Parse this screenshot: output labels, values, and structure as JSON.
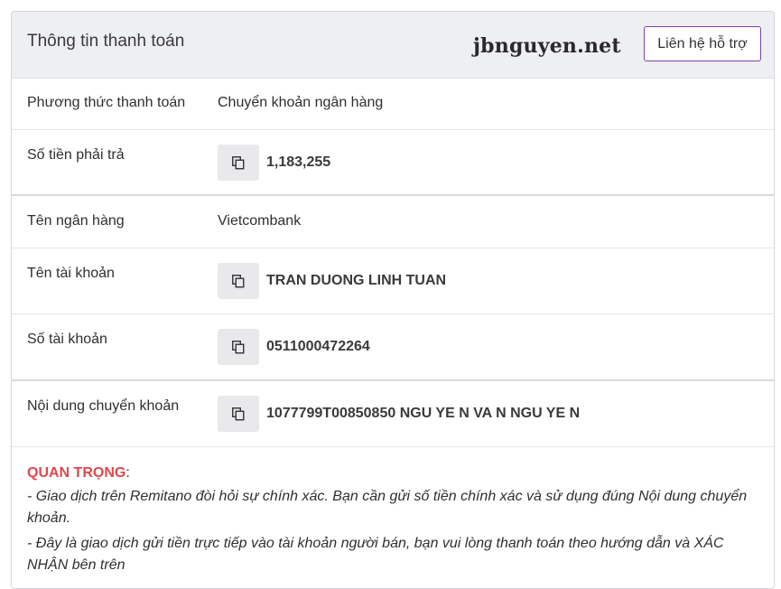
{
  "header": {
    "title": "Thông tin thanh toán",
    "watermark": "jbnguyen.net",
    "support_button": "Liên hệ hỗ trợ"
  },
  "rows": [
    {
      "label": "Phương thức thanh toán",
      "value": "Chuyển khoản ngân hàng",
      "copyable": false
    },
    {
      "label": "Số tiền phải trả",
      "value": "1,183,255",
      "copyable": true
    },
    {
      "label": "Tên ngân hàng",
      "value": "Vietcombank",
      "copyable": false
    },
    {
      "label": "Tên tài khoản",
      "value": "TRAN DUONG LINH TUAN",
      "copyable": true
    },
    {
      "label": "Số tài khoản",
      "value": "0511000472264",
      "copyable": true
    },
    {
      "label": "Nội dung chuyển khoản",
      "value": "1077799T00850850 NGU YE N VA N NGU YE N",
      "copyable": true
    }
  ],
  "notes": {
    "important_label": "QUAN TRỌNG",
    "colon": ":",
    "items": [
      "- Giao dịch trên Remitano đòi hỏi sự chính xác. Bạn cần gửi số tiền chính xác và sử dụng đúng Nội dung chuyển khoản.",
      "- Đây là giao dịch gửi tiền trực tiếp vào tài khoản người bán, bạn vui lòng thanh toán theo hướng dẫn và XÁC NHẬN bên trên"
    ]
  },
  "colors": {
    "accent_border": "#7b3fae",
    "important": "#e0464b",
    "header_bg": "#eeeff2",
    "copy_button_bg": "#e9e9ec"
  },
  "icons": {
    "copy": "copy-icon"
  }
}
